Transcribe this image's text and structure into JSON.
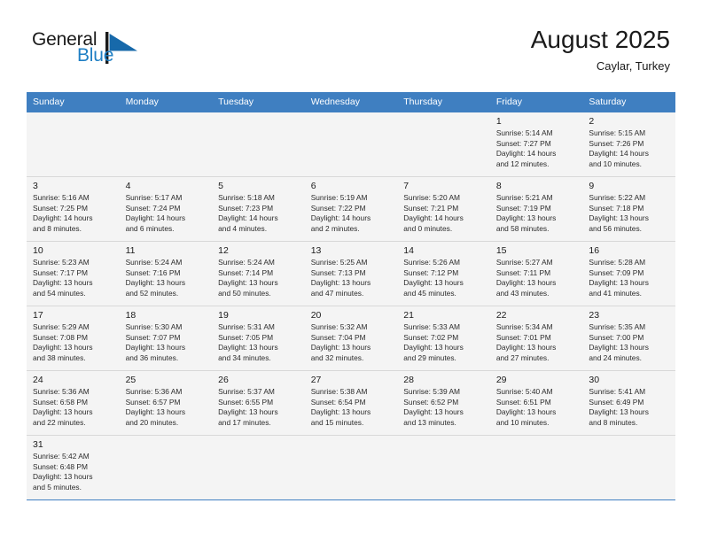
{
  "brand": {
    "name_part1": "General",
    "name_part2": "Blue",
    "mark_icon": "blue-flag-triangle-icon",
    "accent_color": "#1f7fc4"
  },
  "header": {
    "title": "August 2025",
    "subtitle": "Caylar, Turkey"
  },
  "calendar": {
    "header_bg": "#3f7fc1",
    "weekday_headers": [
      "Sunday",
      "Monday",
      "Tuesday",
      "Wednesday",
      "Thursday",
      "Friday",
      "Saturday"
    ],
    "weeks": [
      [
        {
          "day": "",
          "detail": ""
        },
        {
          "day": "",
          "detail": ""
        },
        {
          "day": "",
          "detail": ""
        },
        {
          "day": "",
          "detail": ""
        },
        {
          "day": "",
          "detail": ""
        },
        {
          "day": "1",
          "detail": "Sunrise: 5:14 AM\nSunset: 7:27 PM\nDaylight: 14 hours\nand 12 minutes."
        },
        {
          "day": "2",
          "detail": "Sunrise: 5:15 AM\nSunset: 7:26 PM\nDaylight: 14 hours\nand 10 minutes."
        }
      ],
      [
        {
          "day": "3",
          "detail": "Sunrise: 5:16 AM\nSunset: 7:25 PM\nDaylight: 14 hours\nand 8 minutes."
        },
        {
          "day": "4",
          "detail": "Sunrise: 5:17 AM\nSunset: 7:24 PM\nDaylight: 14 hours\nand 6 minutes."
        },
        {
          "day": "5",
          "detail": "Sunrise: 5:18 AM\nSunset: 7:23 PM\nDaylight: 14 hours\nand 4 minutes."
        },
        {
          "day": "6",
          "detail": "Sunrise: 5:19 AM\nSunset: 7:22 PM\nDaylight: 14 hours\nand 2 minutes."
        },
        {
          "day": "7",
          "detail": "Sunrise: 5:20 AM\nSunset: 7:21 PM\nDaylight: 14 hours\nand 0 minutes."
        },
        {
          "day": "8",
          "detail": "Sunrise: 5:21 AM\nSunset: 7:19 PM\nDaylight: 13 hours\nand 58 minutes."
        },
        {
          "day": "9",
          "detail": "Sunrise: 5:22 AM\nSunset: 7:18 PM\nDaylight: 13 hours\nand 56 minutes."
        }
      ],
      [
        {
          "day": "10",
          "detail": "Sunrise: 5:23 AM\nSunset: 7:17 PM\nDaylight: 13 hours\nand 54 minutes."
        },
        {
          "day": "11",
          "detail": "Sunrise: 5:24 AM\nSunset: 7:16 PM\nDaylight: 13 hours\nand 52 minutes."
        },
        {
          "day": "12",
          "detail": "Sunrise: 5:24 AM\nSunset: 7:14 PM\nDaylight: 13 hours\nand 50 minutes."
        },
        {
          "day": "13",
          "detail": "Sunrise: 5:25 AM\nSunset: 7:13 PM\nDaylight: 13 hours\nand 47 minutes."
        },
        {
          "day": "14",
          "detail": "Sunrise: 5:26 AM\nSunset: 7:12 PM\nDaylight: 13 hours\nand 45 minutes."
        },
        {
          "day": "15",
          "detail": "Sunrise: 5:27 AM\nSunset: 7:11 PM\nDaylight: 13 hours\nand 43 minutes."
        },
        {
          "day": "16",
          "detail": "Sunrise: 5:28 AM\nSunset: 7:09 PM\nDaylight: 13 hours\nand 41 minutes."
        }
      ],
      [
        {
          "day": "17",
          "detail": "Sunrise: 5:29 AM\nSunset: 7:08 PM\nDaylight: 13 hours\nand 38 minutes."
        },
        {
          "day": "18",
          "detail": "Sunrise: 5:30 AM\nSunset: 7:07 PM\nDaylight: 13 hours\nand 36 minutes."
        },
        {
          "day": "19",
          "detail": "Sunrise: 5:31 AM\nSunset: 7:05 PM\nDaylight: 13 hours\nand 34 minutes."
        },
        {
          "day": "20",
          "detail": "Sunrise: 5:32 AM\nSunset: 7:04 PM\nDaylight: 13 hours\nand 32 minutes."
        },
        {
          "day": "21",
          "detail": "Sunrise: 5:33 AM\nSunset: 7:02 PM\nDaylight: 13 hours\nand 29 minutes."
        },
        {
          "day": "22",
          "detail": "Sunrise: 5:34 AM\nSunset: 7:01 PM\nDaylight: 13 hours\nand 27 minutes."
        },
        {
          "day": "23",
          "detail": "Sunrise: 5:35 AM\nSunset: 7:00 PM\nDaylight: 13 hours\nand 24 minutes."
        }
      ],
      [
        {
          "day": "24",
          "detail": "Sunrise: 5:36 AM\nSunset: 6:58 PM\nDaylight: 13 hours\nand 22 minutes."
        },
        {
          "day": "25",
          "detail": "Sunrise: 5:36 AM\nSunset: 6:57 PM\nDaylight: 13 hours\nand 20 minutes."
        },
        {
          "day": "26",
          "detail": "Sunrise: 5:37 AM\nSunset: 6:55 PM\nDaylight: 13 hours\nand 17 minutes."
        },
        {
          "day": "27",
          "detail": "Sunrise: 5:38 AM\nSunset: 6:54 PM\nDaylight: 13 hours\nand 15 minutes."
        },
        {
          "day": "28",
          "detail": "Sunrise: 5:39 AM\nSunset: 6:52 PM\nDaylight: 13 hours\nand 13 minutes."
        },
        {
          "day": "29",
          "detail": "Sunrise: 5:40 AM\nSunset: 6:51 PM\nDaylight: 13 hours\nand 10 minutes."
        },
        {
          "day": "30",
          "detail": "Sunrise: 5:41 AM\nSunset: 6:49 PM\nDaylight: 13 hours\nand 8 minutes."
        }
      ],
      [
        {
          "day": "31",
          "detail": "Sunrise: 5:42 AM\nSunset: 6:48 PM\nDaylight: 13 hours\nand 5 minutes."
        },
        {
          "day": "",
          "detail": ""
        },
        {
          "day": "",
          "detail": ""
        },
        {
          "day": "",
          "detail": ""
        },
        {
          "day": "",
          "detail": ""
        },
        {
          "day": "",
          "detail": ""
        },
        {
          "day": "",
          "detail": ""
        }
      ]
    ]
  }
}
